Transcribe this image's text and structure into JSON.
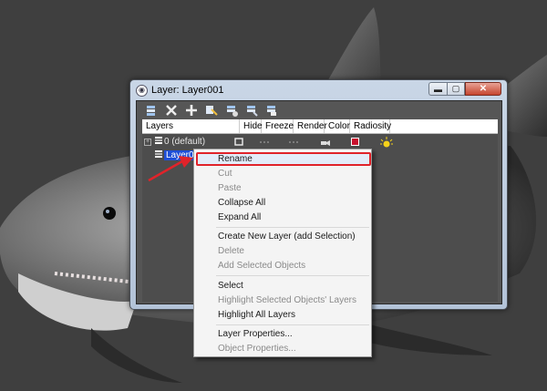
{
  "window": {
    "title": "Layer: Layer001",
    "icon": "app-icon",
    "controls": [
      "minimize",
      "maximize",
      "close"
    ]
  },
  "toolbar": {
    "icons": [
      "create-new-layer-icon",
      "delete-layer-icon",
      "add-to-layer-icon",
      "select-highlighted-icon",
      "highlight-selected-icon",
      "hide-freeze-all-icon",
      "layer-properties-icon"
    ]
  },
  "columns": [
    "Layers",
    "Hide",
    "Freeze",
    "Render",
    "Color",
    "Radiosity"
  ],
  "layers": [
    {
      "name": "0 (default)",
      "selected": false,
      "color": "#c8102e"
    },
    {
      "name": "Layer001",
      "selected": true,
      "color": "#c8102e"
    }
  ],
  "context_menu": {
    "items": [
      {
        "label": "Rename",
        "disabled": false,
        "highlighted": true
      },
      {
        "label": "Cut",
        "disabled": true
      },
      {
        "label": "Paste",
        "disabled": true
      },
      {
        "label": "Collapse All",
        "disabled": false
      },
      {
        "label": "Expand All",
        "disabled": false
      },
      {
        "label": "Create New Layer (add Selection)",
        "disabled": false
      },
      {
        "label": "Delete",
        "disabled": true
      },
      {
        "label": "Add Selected Objects",
        "disabled": true
      },
      {
        "label": "Select",
        "disabled": false
      },
      {
        "label": "Highlight Selected Objects' Layers",
        "disabled": true
      },
      {
        "label": "Highlight All Layers",
        "disabled": false
      },
      {
        "label": "Layer Properties...",
        "disabled": false
      },
      {
        "label": "Object Properties...",
        "disabled": true
      }
    ]
  },
  "colors": {
    "highlight_outline": "#e0232a",
    "annotation_arrow": "#e0232a",
    "selection": "#1e4fd6"
  }
}
